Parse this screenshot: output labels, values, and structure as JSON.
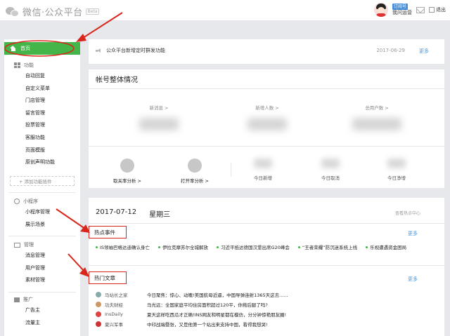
{
  "header": {
    "logo_text": "微信·公众平台",
    "beta": "Beta",
    "account_badge": "订阅号",
    "account_name": "我问运营",
    "logout": "退出"
  },
  "sidebar": {
    "home": "首页",
    "function_title": "功能",
    "function_items": [
      "自动回复",
      "自定义菜单",
      "门店管理",
      "留言管理",
      "投票管理",
      "客服功能",
      "页面模版",
      "原创声明功能"
    ],
    "add_plugin": "+ 添加功能插件",
    "miniprogram_title": "小程序",
    "miniprogram_items": [
      "小程序管理",
      "展示场景"
    ],
    "manage_title": "管理",
    "manage_items": [
      "消息管理",
      "用户管理",
      "素材管理"
    ],
    "promote_title": "推广",
    "promote_items": [
      "广告主",
      "流量主"
    ]
  },
  "notice": {
    "text": "公众平台新增定时群发功能",
    "date": "2017-06-29",
    "more": "更多"
  },
  "overview": {
    "title": "帐号整体情况",
    "stats": [
      {
        "label": "新消息 >"
      },
      {
        "label": "新增人数 >"
      },
      {
        "label": "总用户数 >"
      }
    ],
    "tools": [
      "取关率分析 >",
      "打开率分析 >"
    ],
    "mini_stats": [
      "今日新增",
      "今日取消",
      "今日净增"
    ]
  },
  "daily": {
    "date": "2017-07-12",
    "weekday": "星期三",
    "sub_center": "查看热点中心"
  },
  "hot_events": {
    "title": "热点事件",
    "more": "更多",
    "items": [
      "IS领袖巴格达迪确认身亡",
      "伊拉克摩苏尔全城解放",
      "习近平抵达德国汉堡出席G20峰会",
      "“王者荣耀”防沉迷系统上线",
      "乐视遭遇资金困局"
    ]
  },
  "hot_articles": {
    "title": "热门文章",
    "more": "更多",
    "items": [
      {
        "source": "马站长之家",
        "title": "今日聚焦：惊心、动魄!美国航母近逼，中国导弹连射1365天这去......",
        "color": "#8aa"
      },
      {
        "source": "功夫财经",
        "title": "马光远：全国家庭平均住房面积超过120平，你拖后腿了吗?",
        "color": "#c96"
      },
      {
        "source": "InsDaily",
        "title": "夏天这样吃西瓜才正确!INS网友和明星都在模仿，分分钟惊艳朋友圈!",
        "color": "#d44"
      },
      {
        "source": "夏兴军事",
        "title": "中印战端暨张，又是他第一个站出来支持中国，看得我想哭!",
        "color": "#c33"
      }
    ]
  }
}
